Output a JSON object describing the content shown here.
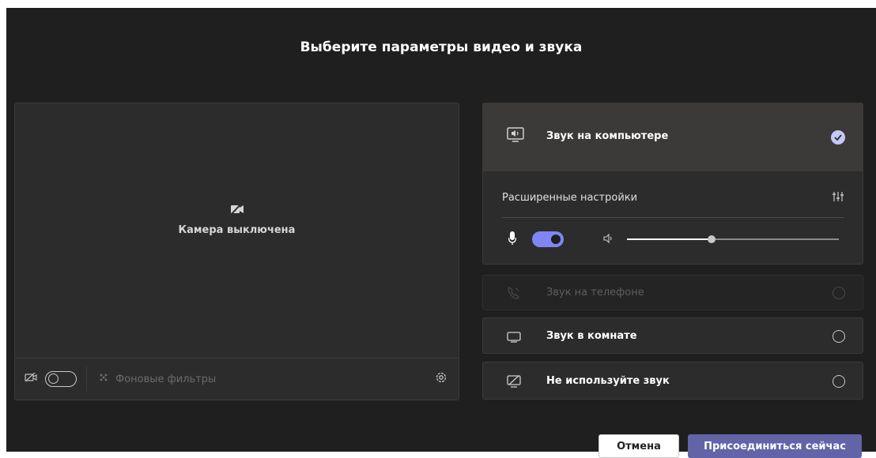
{
  "dialog": {
    "title": "Выберите параметры видео и звука"
  },
  "video": {
    "camera_off_text": "Камера выключена",
    "camera_toggle_state": "off",
    "background_filters_label": "Фоновые фильтры"
  },
  "audio": {
    "computer": {
      "label": "Звук на компьютере",
      "selected": true,
      "advanced_label": "Расширенные настройки",
      "mic_toggle_state": "on",
      "volume_level": 0.4
    },
    "phone": {
      "label": "Звук на телефоне",
      "disabled": true
    },
    "room": {
      "label": "Звук в комнате"
    },
    "no_audio": {
      "label": "Не используйте звук"
    }
  },
  "buttons": {
    "cancel": "Отмена",
    "join": "Присоединиться сейчас"
  },
  "colors": {
    "background": "#1f1f1f",
    "panel": "#2d2c2c",
    "selected_row": "#3b3a39",
    "accent": "#7f85f5",
    "join_button": "#6264a7"
  },
  "icons": {
    "camera_off": "camera-off-icon",
    "background_filters": "background-effects-icon",
    "settings": "gear-icon",
    "computer_audio": "computer-speaker-icon",
    "advanced": "sliders-icon",
    "mic": "microphone-icon",
    "speaker": "speaker-icon",
    "phone": "phone-audio-icon",
    "room": "room-display-icon",
    "no_audio": "audio-off-icon"
  }
}
